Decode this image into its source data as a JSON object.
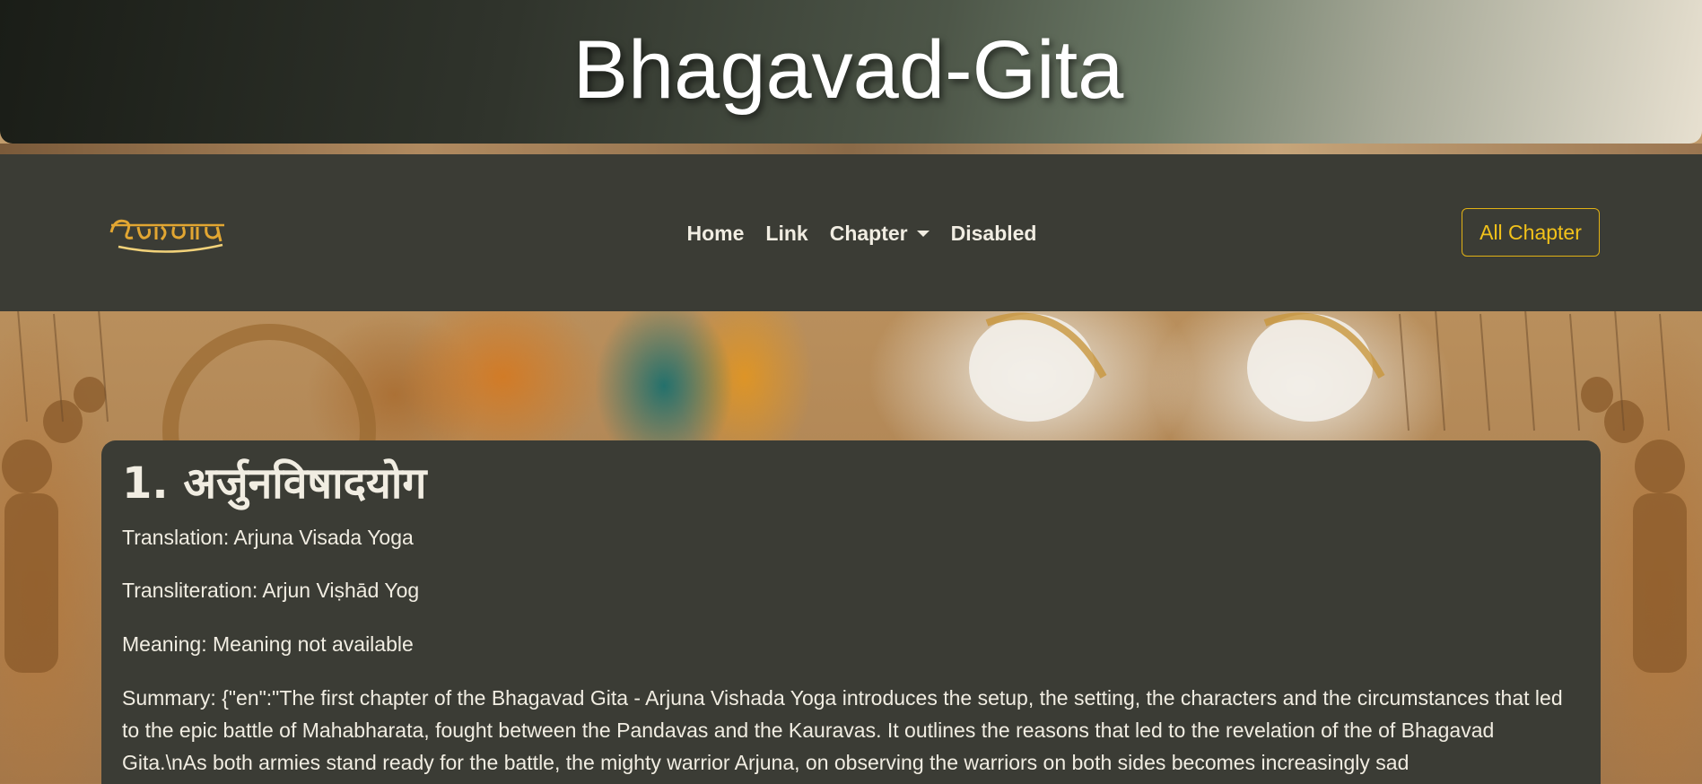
{
  "header": {
    "title": "Bhagavad-Gita"
  },
  "navbar": {
    "brand_alt": "श्रीमद् भागवत कथा",
    "links": [
      {
        "label": "Home"
      },
      {
        "label": "Link"
      },
      {
        "label": "Chapter"
      },
      {
        "label": "Disabled"
      }
    ],
    "all_chapter_label": "All Chapter",
    "accent_color": "#f2c21a"
  },
  "chapter": {
    "title": "1. अर्जुनविषादयोग",
    "translation": "Translation: Arjuna Visada Yoga",
    "transliteration": "Transliteration: Arjun Viṣhād Yog",
    "meaning": "Meaning: Meaning not available",
    "summary": "Summary: {\"en\":\"The first chapter of the Bhagavad Gita - Arjuna Vishada Yoga introduces the setup, the setting, the characters and the circumstances that led to the epic battle of Mahabharata, fought between the Pandavas and the Kauravas. It outlines the reasons that led to the revelation of the of Bhagavad Gita.\\nAs both armies stand ready for the battle, the mighty warrior Arjuna, on observing the warriors on both sides becomes increasingly sad"
  }
}
